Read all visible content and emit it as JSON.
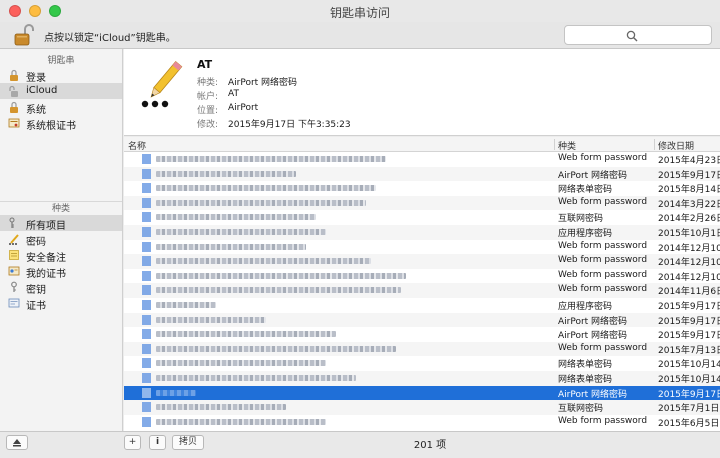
{
  "window": {
    "title": "钥匙串访问"
  },
  "toolbar": {
    "lock_text": "点按以锁定“iCloud”钥匙串。",
    "search_placeholder": ""
  },
  "sidebar": {
    "keychains_header": "钥匙串",
    "keychains": [
      {
        "label": "登录",
        "icon": "login-keychain-icon",
        "selected": false
      },
      {
        "label": "iCloud",
        "icon": "icloud-keychain-icon",
        "selected": true
      },
      {
        "label": "系统",
        "icon": "system-keychain-icon",
        "selected": false
      },
      {
        "label": "系统根证书",
        "icon": "system-roots-icon",
        "selected": false
      }
    ],
    "categories_header": "种类",
    "categories": [
      {
        "label": "所有项目",
        "icon": "all-items-icon",
        "selected": true
      },
      {
        "label": "密码",
        "icon": "password-icon",
        "selected": false
      },
      {
        "label": "安全备注",
        "icon": "secure-note-icon",
        "selected": false
      },
      {
        "label": "我的证书",
        "icon": "my-certificates-icon",
        "selected": false
      },
      {
        "label": "密钥",
        "icon": "key-icon",
        "selected": false
      },
      {
        "label": "证书",
        "icon": "certificate-icon",
        "selected": false
      }
    ]
  },
  "detail": {
    "title": "AT",
    "kind_label": "种类:",
    "kind_value": "AirPort 网络密码",
    "account_label": "帐户:",
    "account_value": "AT",
    "where_label": "位置:",
    "where_value": "AirPort",
    "modified_label": "修改:",
    "modified_value": "2015年9月17日 下午3:35:23"
  },
  "table": {
    "columns": [
      "名称",
      "种类",
      "修改日期"
    ],
    "rows": [
      {
        "kind": "Web form password",
        "date": "2015年4月23日",
        "selected": false
      },
      {
        "kind": "AirPort 网络密码",
        "date": "2015年9月17日",
        "selected": false
      },
      {
        "kind": "网络表单密码",
        "date": "2015年8月14日",
        "selected": false
      },
      {
        "kind": "Web form password",
        "date": "2014年3月22日",
        "selected": false
      },
      {
        "kind": "互联网密码",
        "date": "2014年2月26日",
        "selected": false
      },
      {
        "kind": "应用程序密码",
        "date": "2015年10月1日",
        "selected": false
      },
      {
        "kind": "Web form password",
        "date": "2014年12月10日",
        "selected": false
      },
      {
        "kind": "Web form password",
        "date": "2014年12月10日",
        "selected": false
      },
      {
        "kind": "Web form password",
        "date": "2014年12月10日",
        "selected": false
      },
      {
        "kind": "Web form password",
        "date": "2014年11月6日",
        "selected": false
      },
      {
        "kind": "应用程序密码",
        "date": "2015年9月17日",
        "selected": false
      },
      {
        "kind": "AirPort 网络密码",
        "date": "2015年9月17日",
        "selected": false
      },
      {
        "kind": "AirPort 网络密码",
        "date": "2015年9月17日",
        "selected": false
      },
      {
        "kind": "Web form password",
        "date": "2015年7月13日",
        "selected": false
      },
      {
        "kind": "网络表单密码",
        "date": "2015年10月14日",
        "selected": false
      },
      {
        "kind": "网络表单密码",
        "date": "2015年10月14日",
        "selected": false
      },
      {
        "kind": "AirPort 网络密码",
        "date": "2015年9月17日",
        "selected": true
      },
      {
        "kind": "互联网密码",
        "date": "2015年7月1日",
        "selected": false
      },
      {
        "kind": "Web form password",
        "date": "2015年6月5日",
        "selected": false
      }
    ]
  },
  "bottombar": {
    "copy_label": "拷贝",
    "item_count": "201 项",
    "add_label": "+",
    "info_label": "i"
  },
  "colors": {
    "selection": "#1f6fd8",
    "row_alt": "#f5f5f5"
  }
}
